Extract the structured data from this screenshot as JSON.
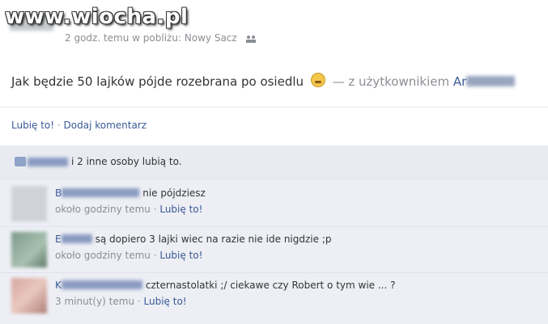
{
  "watermark": "www.wiocha.pl",
  "post": {
    "meta": "2 godz. temu w pobliżu: Nowy Sacz",
    "text": "Jak będzie 50 lajków pójde rozebrana po osiedlu",
    "with_prefix": "— z użytkownikiem",
    "with_name": "Ar"
  },
  "actions": {
    "like": "Lubię to!",
    "separator": " · ",
    "comment": "Dodaj komentarz"
  },
  "likes": {
    "text": "i 2 inne osoby lubią to."
  },
  "comments": [
    {
      "author": "B",
      "text": "nie pójdziesz",
      "time": "około godziny temu",
      "like": "Lubię to!"
    },
    {
      "author": "E",
      "text": "są dopiero 3 lajki wiec na razie nie ide nigdzie ;p",
      "time": "około godziny temu",
      "like": "Lubię to!"
    },
    {
      "author": "K",
      "text": "czternastolatki ;/ ciekawe czy Robert o tym wie ... ?",
      "time": "3 minut(y) temu",
      "like": "Lubię to!"
    }
  ]
}
